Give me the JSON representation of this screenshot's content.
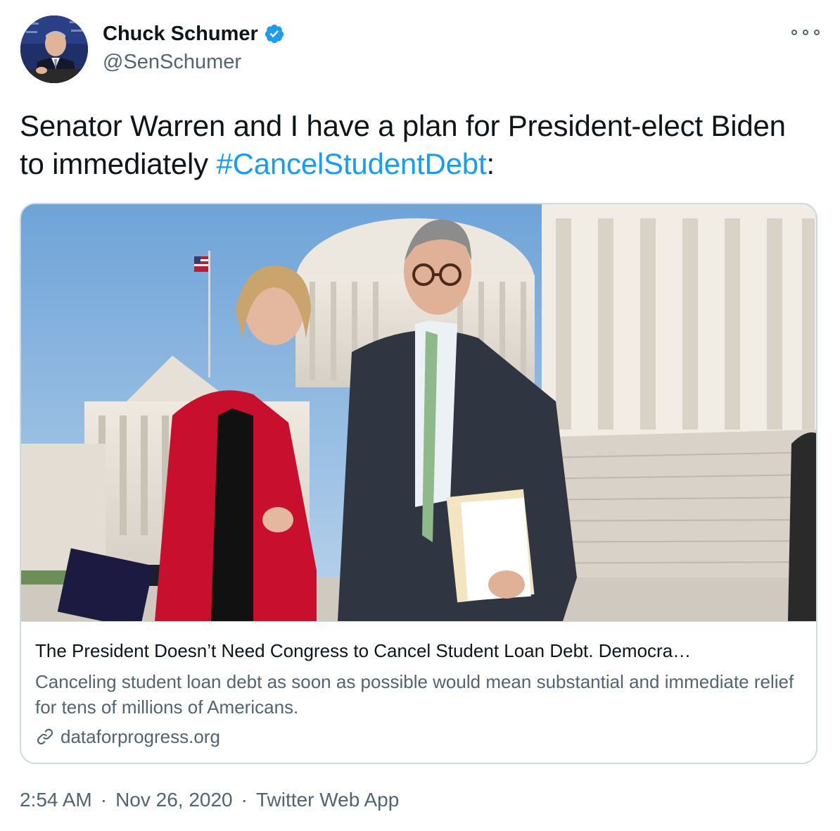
{
  "author": {
    "display_name": "Chuck Schumer",
    "handle": "@SenSchumer",
    "verified_icon": "verified-badge-icon",
    "accent_color": "#1d9bf0"
  },
  "tweet": {
    "text_before": "Senator Warren and I have a plan for President-elect Biden to immediately ",
    "hashtag": "#CancelStudentDebt",
    "text_after": ":"
  },
  "card": {
    "title": "The President Doesn’t Need Congress to Cancel Student Loan Debt. Democra…",
    "description": "Canceling student loan debt as soon as possible would mean substantial and immediate relief for tens of millions of Americans.",
    "domain": "dataforprogress.org",
    "link_icon": "link-icon"
  },
  "meta": {
    "time": "2:54 AM",
    "date": "Nov 26, 2020",
    "source": "Twitter Web App",
    "separator": "·"
  },
  "icons": {
    "more": "more-options-icon"
  }
}
